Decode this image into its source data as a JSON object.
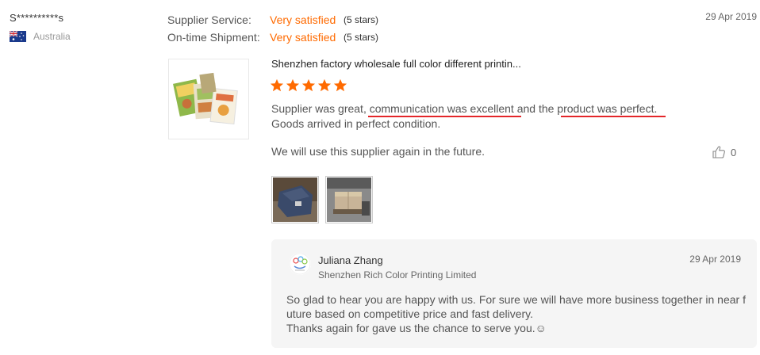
{
  "reviewer": {
    "name": "S**********s",
    "country": "Australia"
  },
  "ratings": [
    {
      "label": "Supplier Service:",
      "value": "Very satisfied",
      "stars": "(5 stars)"
    },
    {
      "label": "On-time Shipment:",
      "value": "Very satisfied",
      "stars": "(5 stars)"
    }
  ],
  "review": {
    "date": "29 Apr 2019",
    "product_title": "Shenzhen factory wholesale full color different printin...",
    "star_rating": 5,
    "text_line1": "Supplier was great, communication was excellent and the product was perfect.",
    "text_line2": "Goods arrived in perfect condition.",
    "text_line3": "We will use this supplier again in the future.",
    "likes": "0"
  },
  "reply": {
    "name": "Juliana Zhang",
    "company": "Shenzhen Rich Color Printing Limited",
    "date": "29 Apr 2019",
    "text_line1": "So glad to hear you are happy with us. For sure we will have more  business together in near future based on competitive price and fast delivery.",
    "text_line2": "Thanks again for gave us the chance to serve you.☺"
  },
  "colors": {
    "accent": "#ff6a00",
    "annotation": "#e4262a",
    "reply_bg": "#f5f5f5"
  }
}
